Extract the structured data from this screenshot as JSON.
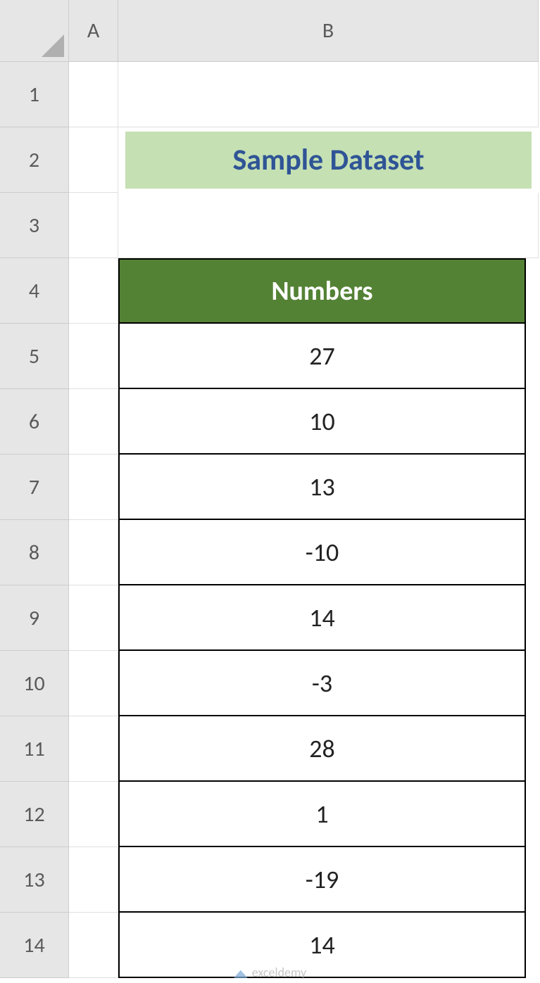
{
  "columns": [
    "A",
    "B"
  ],
  "rows": [
    "1",
    "2",
    "3",
    "4",
    "5",
    "6",
    "7",
    "8",
    "9",
    "10",
    "11",
    "12",
    "13",
    "14"
  ],
  "title": "Sample Dataset",
  "table_header": "Numbers",
  "numbers": [
    "27",
    "10",
    "13",
    "-10",
    "14",
    "-3",
    "28",
    "1",
    "-19",
    "14"
  ],
  "watermark": "exceldemy"
}
